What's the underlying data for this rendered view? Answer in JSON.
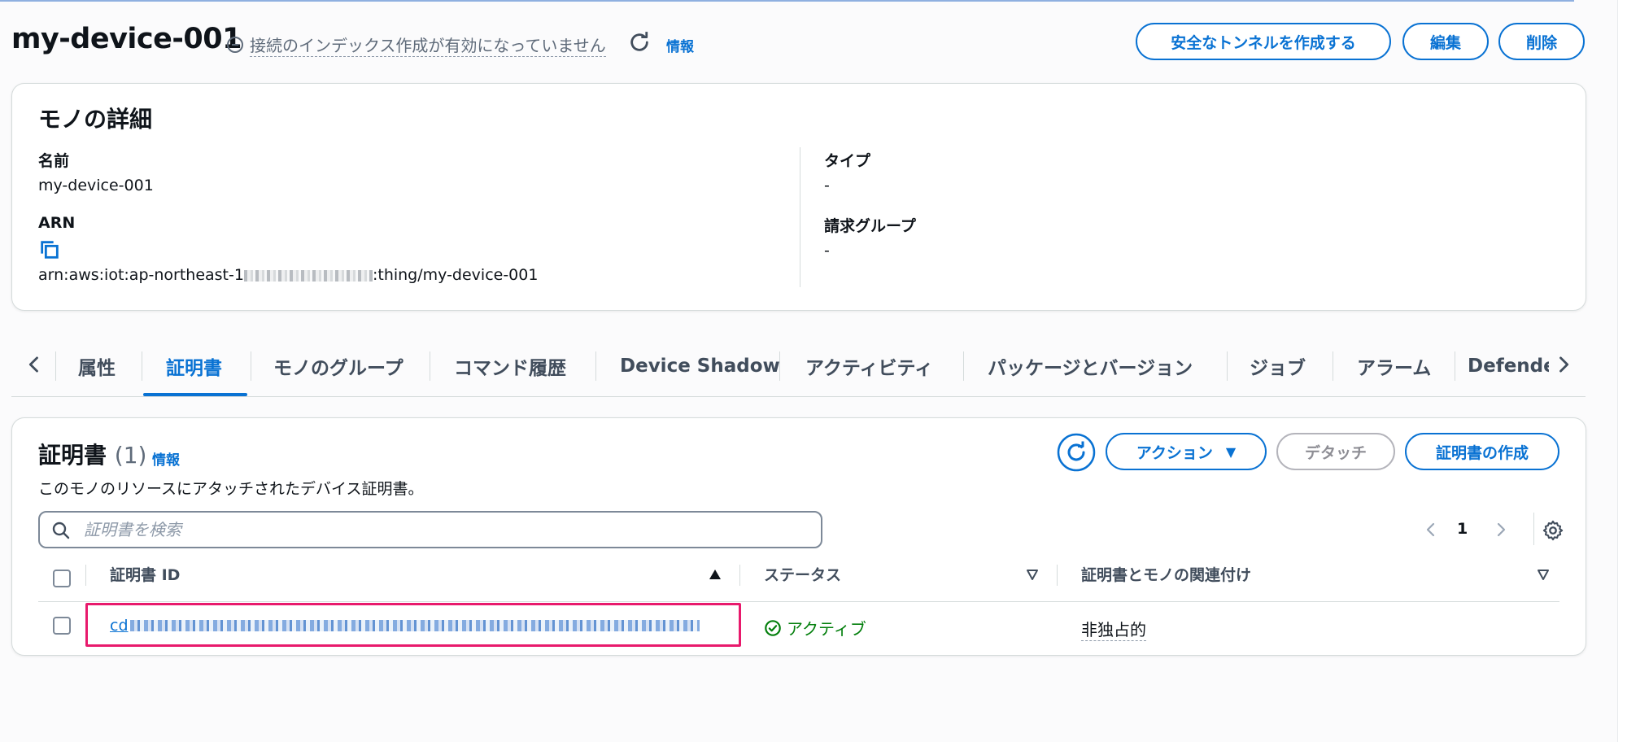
{
  "header": {
    "title": "my-device-001",
    "status": "接続のインデックス作成が有効になっていません",
    "info": "情報",
    "buttons": {
      "tunnel": "安全なトンネルを作成する",
      "edit": "編集",
      "delete": "削除"
    }
  },
  "details": {
    "title": "モノの詳細",
    "name_label": "名前",
    "name_value": "my-device-001",
    "arn_label": "ARN",
    "arn_prefix": "arn:aws:iot:ap-northeast-1",
    "arn_suffix": ":thing/my-device-001",
    "type_label": "タイプ",
    "type_value": "-",
    "billing_label": "請求グループ",
    "billing_value": "-"
  },
  "tabs": [
    {
      "label": "属性"
    },
    {
      "label": "証明書",
      "active": true
    },
    {
      "label": "モノのグループ"
    },
    {
      "label": "コマンド履歴"
    },
    {
      "label": "Device Shadow"
    },
    {
      "label": "アクティビティ"
    },
    {
      "label": "パッケージとバージョン"
    },
    {
      "label": "ジョブ"
    },
    {
      "label": "アラーム"
    },
    {
      "label": "Defender"
    }
  ],
  "certificates": {
    "title": "証明書",
    "count": "(1)",
    "info": "情報",
    "description": "このモノのリソースにアタッチされたデバイス証明書。",
    "actions_label": "アクション",
    "detach_label": "デタッチ",
    "create_label": "証明書の作成",
    "search_placeholder": "証明書を検索",
    "page": "1",
    "columns": {
      "id": "証明書 ID",
      "status": "ステータス",
      "association": "証明書とモノの関連付け"
    },
    "rows": [
      {
        "id_prefix": "cd",
        "status": "アクティブ",
        "association": "非独占的"
      }
    ]
  },
  "colors": {
    "accent": "#0972d3",
    "success": "#037f0c",
    "highlight": "#e8196c"
  }
}
